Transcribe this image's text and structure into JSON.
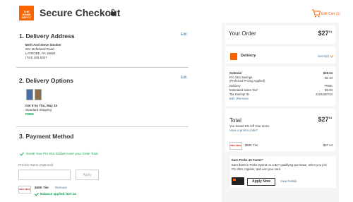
{
  "header": {
    "logo_text": "THE HOME DEPOT",
    "title": "Secure Checkout",
    "cart_label": "Edit Cart (1)"
  },
  "delivery_address": {
    "title": "1. Delivery Address",
    "edit": "Edit",
    "name": "Beth And Steve Smoker",
    "street": "524 Mcfarland Road",
    "city": "LATROBE, PA 15650",
    "phone": "(724) 493-5327"
  },
  "delivery_options": {
    "title": "2. Delivery Options",
    "edit": "Edit",
    "get_by": "Get it by Thu, May 15",
    "method": "Standard Shipping",
    "price": "FREE"
  },
  "payment": {
    "title": "3. Payment Method",
    "pro_xtra_msg": "Great! Your Pro Xtra Dollars cover your Order Total",
    "po_placeholder": "PO/Job Name (Optional)",
    "apply_label": "Apply",
    "card_label": "$50K Tier",
    "card_tile": "PRO XTRA",
    "remove": "Remove",
    "balance_applied": "Balance applied: $27.14"
  },
  "order": {
    "title": "Your Order",
    "total_top": {
      "dollars": "$27",
      "cents": "14"
    },
    "delivery_label": "Delivery",
    "items_label": "Items(2)",
    "subtotal_label": "Subtotal",
    "subtotal_value": "$29.54",
    "savings_label": "Pro Xtra Savings",
    "savings_sub": "(Preferred Pricing Applied)",
    "savings_value": "-$2.40",
    "delivery_row_label": "Delivery",
    "delivery_row_value": "FREE",
    "tax_label": "Estimated Sales Tax*",
    "tax_value": "$0.00",
    "tax_exempt_label": "Tax Exempt ID",
    "tax_exempt_value": "2104180724",
    "edit_remove": "Edit | Remove",
    "total_label": "Total",
    "total": {
      "dollars": "$27",
      "cents": "14"
    },
    "saved_msg": "You Saved 8% Off Your Items",
    "promo": "Have a promo code?",
    "card_label": "$50K Tier",
    "card_value": "$27.14",
    "card_tile": "PRO XTRA"
  },
  "perks": {
    "title": "Earn Perks 4X Faster*",
    "body": "Earn $100 in Perks Spend on a $27 qualifying purchase, when you join Pro Xtra, register, and use your card.",
    "apply_now": "Apply Now",
    "view_details": "View Details"
  },
  "colors": {
    "brand": "#f96302",
    "link": "#3e7697",
    "green": "#00a650"
  }
}
